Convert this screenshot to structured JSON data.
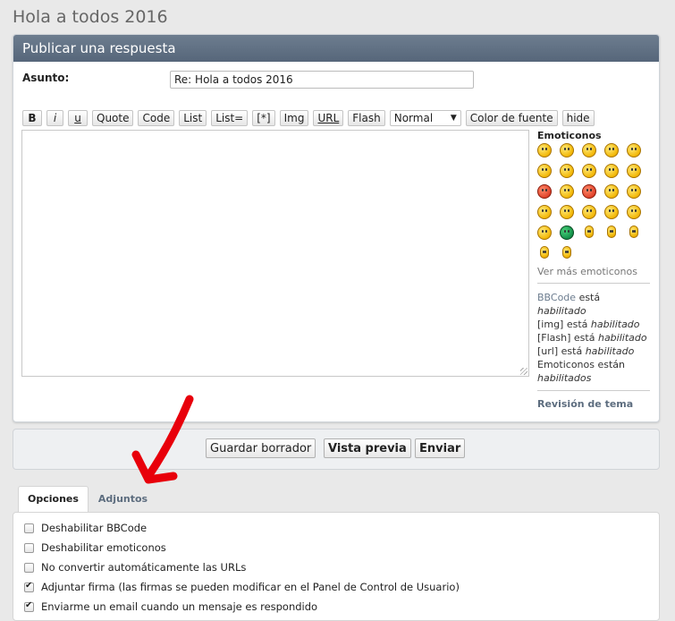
{
  "page": {
    "title": "Hola a todos 2016"
  },
  "panel": {
    "header": "Publicar una respuesta"
  },
  "subject": {
    "label": "Asunto:",
    "value": "Re: Hola a todos 2016"
  },
  "toolbar": {
    "buttons": [
      "B",
      "i",
      "u",
      "Quote",
      "Code",
      "List",
      "List=",
      "[*]",
      "Img",
      "URL",
      "Flash"
    ],
    "font_size_selected": "Normal",
    "color_button": "Color de fuente",
    "hide_button": "hide"
  },
  "sidebar": {
    "emoticons_title": "Emoticonos",
    "more_emoticons": "Ver más emoticonos",
    "bbcode_link": "BBCode",
    "bbcode_status_word": "está",
    "bbcode_status": "habilitado",
    "img_line": "[img] está",
    "img_status": "habilitado",
    "flash_line": "[Flash] está",
    "flash_status": "habilitado",
    "url_line": "[url] está",
    "url_status": "habilitado",
    "emo_line": "Emoticonos están",
    "emo_status": "habilitados",
    "revision": "Revisión de tema"
  },
  "actions": {
    "save_draft": "Guardar borrador",
    "preview": "Vista previa",
    "submit": "Enviar"
  },
  "tabs": {
    "options": "Opciones",
    "attachments": "Adjuntos"
  },
  "options": [
    {
      "label": "Deshabilitar BBCode",
      "checked": false
    },
    {
      "label": "Deshabilitar emoticonos",
      "checked": false
    },
    {
      "label": "No convertir automáticamente las URLs",
      "checked": false
    },
    {
      "label": "Adjuntar firma (las firmas se pueden modificar en el Panel de Control de Usuario)",
      "checked": true
    },
    {
      "label": "Enviarme un email cuando un mensaje es respondido",
      "checked": true
    }
  ],
  "colors": {
    "header_bg": "#5d6d80",
    "arrow": "#e8000b",
    "link": "#6d7d8f"
  }
}
